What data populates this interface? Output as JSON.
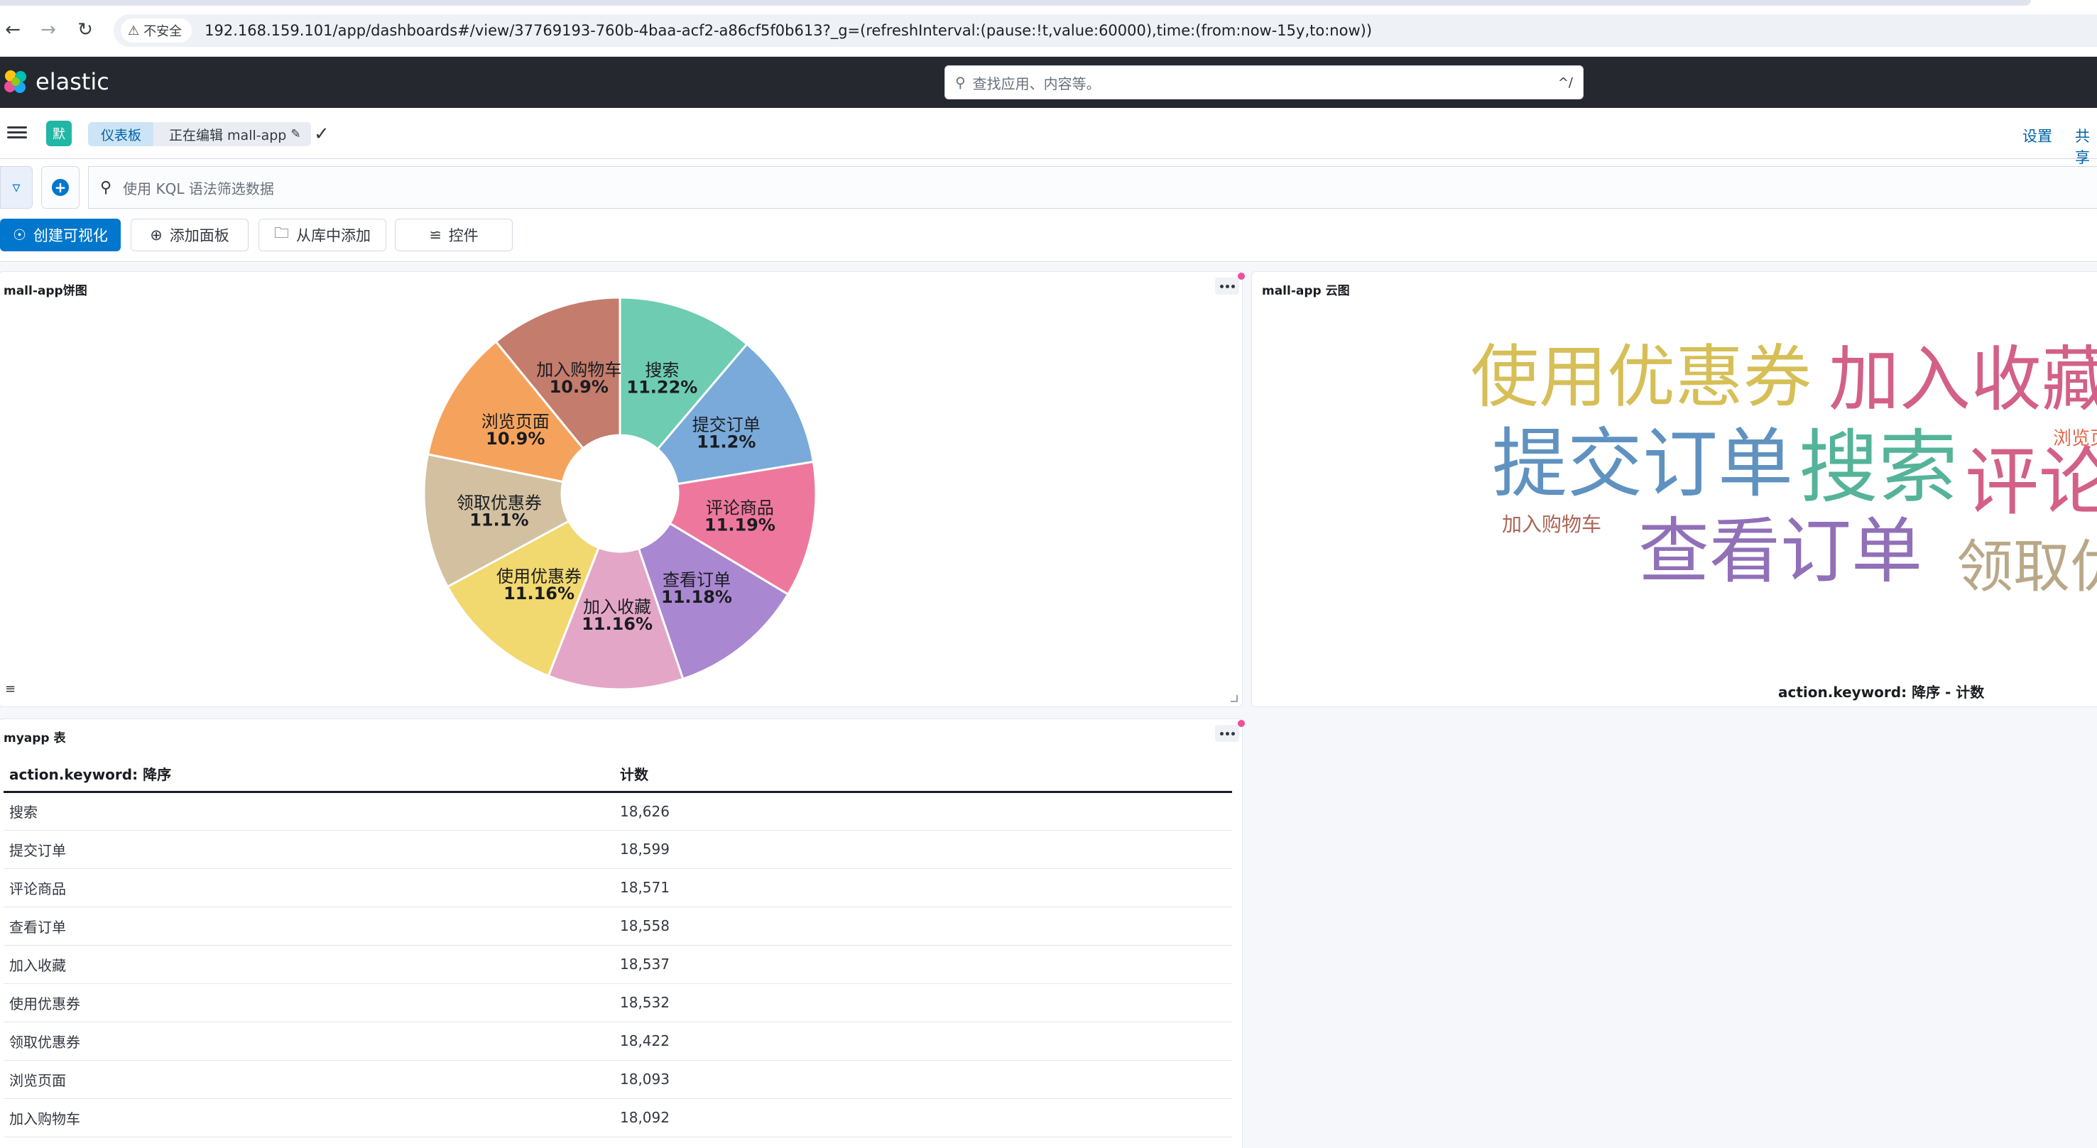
{
  "browser": {
    "insecure_label": "不安全",
    "url": "192.168.159.101/app/dashboards#/view/37769193-760b-4baa-acf2-a86cf5f0b613?_g=(refreshInterval:(pause:!t,value:60000),time:(from:now-15y,to:now))"
  },
  "header": {
    "logo_text": "elastic",
    "search_placeholder": "查找应用、内容等。",
    "search_shortcut": "^/"
  },
  "breadcrumbs": {
    "space_initial": "默",
    "root": "仪表板",
    "current": "正在编辑 mall-app",
    "settings_link": "设置",
    "share_link": "共享"
  },
  "query": {
    "placeholder": "使用 KQL 语法筛选数据"
  },
  "toolbar": {
    "create_viz": "创建可视化",
    "add_panel": "添加面板",
    "add_from_library": "从库中添加",
    "controls": "控件"
  },
  "pie_panel": {
    "title": "mall-app饼图",
    "chart_data": {
      "type": "pie",
      "donut": true,
      "slices": [
        {
          "label": "搜索",
          "percent_label": "11.22%",
          "value": 11.22,
          "color": "#6dccb1"
        },
        {
          "label": "提交订单",
          "percent_label": "11.2%",
          "value": 11.2,
          "color": "#79aad9"
        },
        {
          "label": "评论商品",
          "percent_label": "11.19%",
          "value": 11.19,
          "color": "#ee789d"
        },
        {
          "label": "查看订单",
          "percent_label": "11.18%",
          "value": 11.18,
          "color": "#a987d1"
        },
        {
          "label": "加入收藏",
          "percent_label": "11.16%",
          "value": 11.16,
          "color": "#e4a6c7"
        },
        {
          "label": "使用优惠券",
          "percent_label": "11.16%",
          "value": 11.16,
          "color": "#f1d86f"
        },
        {
          "label": "领取优惠券",
          "percent_label": "11.1%",
          "value": 11.1,
          "color": "#d2c0a0"
        },
        {
          "label": "浏览页面",
          "percent_label": "10.9%",
          "value": 10.9,
          "color": "#f5a35c"
        },
        {
          "label": "加入购物车",
          "percent_label": "10.9%",
          "value": 10.9,
          "color": "#c47c6c"
        }
      ]
    }
  },
  "cloud_panel": {
    "title": "mall-app 云图",
    "axis_label": "action.keyword: 降序 - 计数",
    "words": [
      {
        "text": "使用优惠券",
        "color": "#d6bf57"
      },
      {
        "text": "加入收藏",
        "color": "#d36086"
      },
      {
        "text": "浏览页面",
        "color": "#e7664c"
      },
      {
        "text": "提交订单",
        "color": "#6092c0"
      },
      {
        "text": "搜索",
        "color": "#54b399"
      },
      {
        "text": "评论商品",
        "color": "#d36086"
      },
      {
        "text": "加入购物车",
        "color": "#aa6556"
      },
      {
        "text": "查看订单",
        "color": "#9170b8"
      },
      {
        "text": "领取优惠券",
        "color": "#b9a888"
      }
    ]
  },
  "table_panel": {
    "title": "myapp 表",
    "columns": [
      "action.keyword: 降序",
      "计数"
    ],
    "rows": [
      [
        "搜索",
        "18,626"
      ],
      [
        "提交订单",
        "18,599"
      ],
      [
        "评论商品",
        "18,571"
      ],
      [
        "查看订单",
        "18,558"
      ],
      [
        "加入收藏",
        "18,537"
      ],
      [
        "使用优惠券",
        "18,532"
      ],
      [
        "领取优惠券",
        "18,422"
      ],
      [
        "浏览页面",
        "18,093"
      ],
      [
        "加入购物车",
        "18,092"
      ]
    ]
  }
}
